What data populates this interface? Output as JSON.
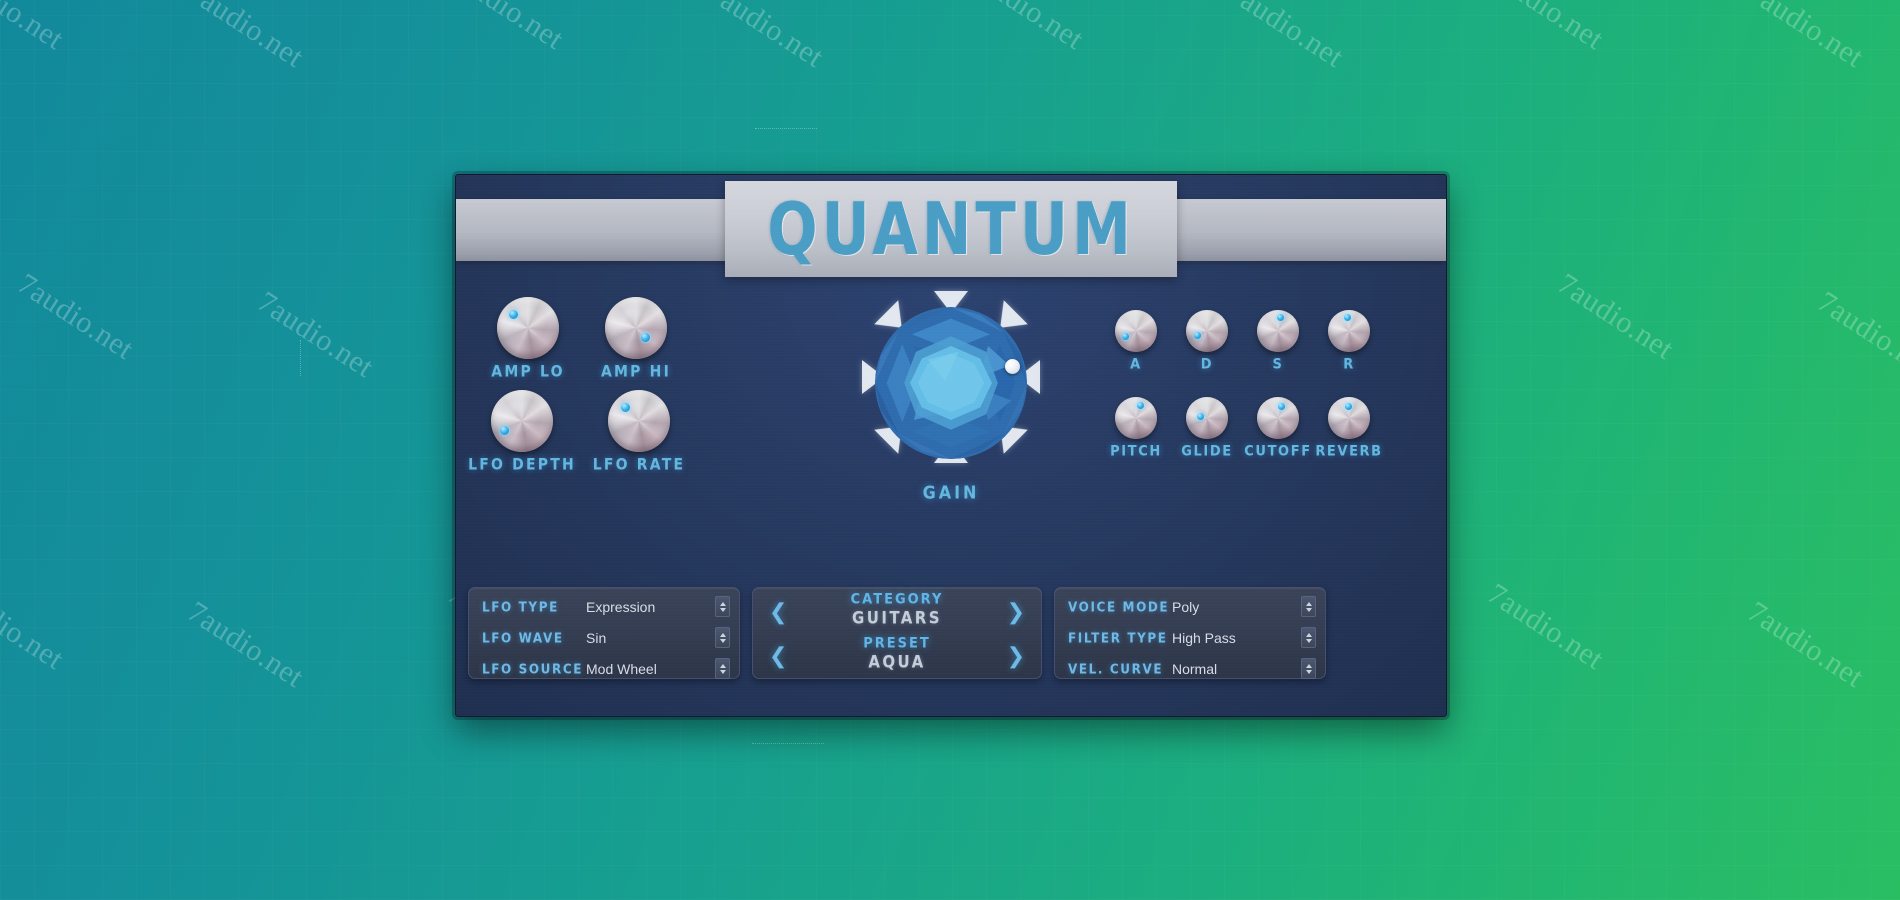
{
  "background": {
    "watermark_text": "7audio.net",
    "accent_teal": "#12899b",
    "accent_green": "#2abe63"
  },
  "plugin": {
    "title": "QUANTUM",
    "accent_color": "#63b7df",
    "body_color": "#26395f"
  },
  "knobs": {
    "left": [
      {
        "label": "AMP LO",
        "angle": -128
      },
      {
        "label": "AMP HI",
        "angle": 45
      },
      {
        "label": "LFO DEPTH",
        "angle": -150
      },
      {
        "label": "LFO RATE",
        "angle": -128
      }
    ],
    "right_top": [
      {
        "label": "A",
        "angle": -140
      },
      {
        "label": "D",
        "angle": -148
      },
      {
        "label": "S",
        "angle": 8
      },
      {
        "label": "R",
        "angle": -6
      }
    ],
    "right_bottom": [
      {
        "label": "PITCH",
        "angle": 16
      },
      {
        "label": "GLIDE",
        "angle": -38
      },
      {
        "label": "CUTOFF",
        "angle": 6
      },
      {
        "label": "REVERB",
        "angle": -12
      }
    ]
  },
  "gain": {
    "label": "GAIN",
    "gem_color_outer": "#2d6aab",
    "gem_color_inner": "#67bde6"
  },
  "panel_left": {
    "rows": [
      {
        "label": "LFO TYPE",
        "value": "Expression"
      },
      {
        "label": "LFO WAVE",
        "value": "Sin"
      },
      {
        "label": "LFO SOURCE",
        "value": "Mod Wheel"
      }
    ]
  },
  "panel_center": {
    "rows": [
      {
        "title": "CATEGORY",
        "value": "GUITARS",
        "prev": "❮",
        "next": "❯"
      },
      {
        "title": "PRESET",
        "value": "AQUA",
        "prev": "❮",
        "next": "❯"
      }
    ]
  },
  "panel_right": {
    "rows": [
      {
        "label": "VOICE MODE",
        "value": "Poly"
      },
      {
        "label": "FILTER TYPE",
        "value": "High Pass"
      },
      {
        "label": "VEL. CURVE",
        "value": "Normal"
      }
    ]
  }
}
